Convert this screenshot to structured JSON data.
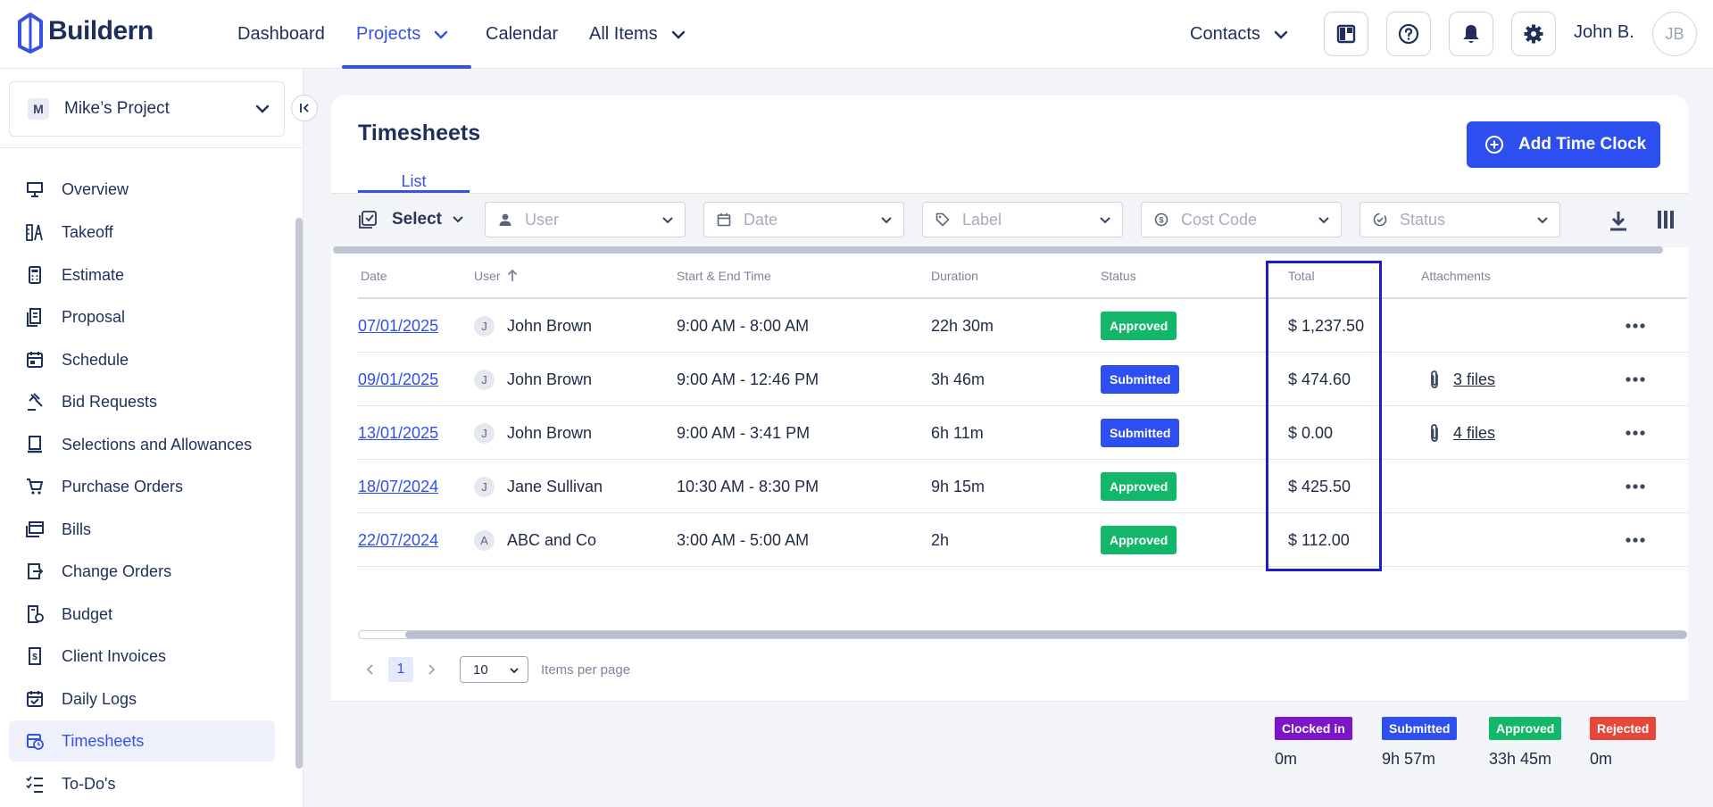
{
  "app": {
    "name": "Buildern"
  },
  "nav": {
    "dashboard": "Dashboard",
    "projects": "Projects",
    "calendar": "Calendar",
    "all_items": "All Items",
    "contacts": "Contacts",
    "user_name": "John B.",
    "user_initials": "JB"
  },
  "project": {
    "letter": "M",
    "name": "Mike’s Project"
  },
  "sidebar": {
    "items": [
      {
        "label": "Overview",
        "icon": "presentation-icon"
      },
      {
        "label": "Takeoff",
        "icon": "takeoff-icon"
      },
      {
        "label": "Estimate",
        "icon": "calculator-icon"
      },
      {
        "label": "Proposal",
        "icon": "proposal-icon"
      },
      {
        "label": "Schedule",
        "icon": "calendar-icon"
      },
      {
        "label": "Bid Requests",
        "icon": "gavel-icon"
      },
      {
        "label": "Selections and Allowances",
        "icon": "selections-icon"
      },
      {
        "label": "Purchase Orders",
        "icon": "cart-icon"
      },
      {
        "label": "Bills",
        "icon": "bills-icon"
      },
      {
        "label": "Change Orders",
        "icon": "change-order-icon"
      },
      {
        "label": "Budget",
        "icon": "budget-icon"
      },
      {
        "label": "Client Invoices",
        "icon": "invoice-icon"
      },
      {
        "label": "Daily Logs",
        "icon": "daily-log-icon"
      },
      {
        "label": "Timesheets",
        "icon": "timesheet-icon"
      },
      {
        "label": "To-Do's",
        "icon": "todo-icon"
      }
    ],
    "active": "Timesheets"
  },
  "page": {
    "title": "Timesheets",
    "tab": "List",
    "add_button": "Add Time Clock"
  },
  "filters": {
    "select": "Select",
    "user": "User",
    "date": "Date",
    "label": "Label",
    "cost_code": "Cost Code",
    "status": "Status"
  },
  "table": {
    "headers": {
      "date": "Date",
      "user": "User",
      "time": "Start & End Time",
      "duration": "Duration",
      "status": "Status",
      "total": "Total",
      "attachments": "Attachments"
    },
    "rows": [
      {
        "date": "07/01/2025",
        "initial": "J",
        "user": "John Brown",
        "time": "9:00 AM - 8:00 AM",
        "duration": "22h 30m",
        "status": "Approved",
        "total": "$ 1,237.50",
        "attachments": ""
      },
      {
        "date": "09/01/2025",
        "initial": "J",
        "user": "John Brown",
        "time": "9:00 AM - 12:46 PM",
        "duration": "3h 46m",
        "status": "Submitted",
        "total": "$ 474.60",
        "attachments": "3 files"
      },
      {
        "date": "13/01/2025",
        "initial": "J",
        "user": "John Brown",
        "time": "9:00 AM - 3:41 PM",
        "duration": "6h 11m",
        "status": "Submitted",
        "total": "$ 0.00",
        "attachments": "4 files"
      },
      {
        "date": "18/07/2024",
        "initial": "J",
        "user": "Jane Sullivan",
        "time": "10:30 AM - 8:30 PM",
        "duration": "9h 15m",
        "status": "Approved",
        "total": "$ 425.50",
        "attachments": ""
      },
      {
        "date": "22/07/2024",
        "initial": "A",
        "user": "ABC and Co",
        "time": "3:00 AM - 5:00 AM",
        "duration": "2h",
        "status": "Approved",
        "total": "$ 112.00",
        "attachments": ""
      }
    ]
  },
  "pagination": {
    "page": "1",
    "per_page": "10",
    "per_page_label": "Items per page"
  },
  "summary": [
    {
      "label": "Clocked in",
      "value": "0m",
      "color": "#7a16c8"
    },
    {
      "label": "Submitted",
      "value": "9h 57m",
      "color": "#2e4ff0"
    },
    {
      "label": "Approved",
      "value": "33h 45m",
      "color": "#12b76a"
    },
    {
      "label": "Rejected",
      "value": "0m",
      "color": "#e5483b"
    }
  ],
  "colors": {
    "accent": "#2e4ff0",
    "approved": "#12b76a",
    "brand_text": "#1f2f5c"
  }
}
